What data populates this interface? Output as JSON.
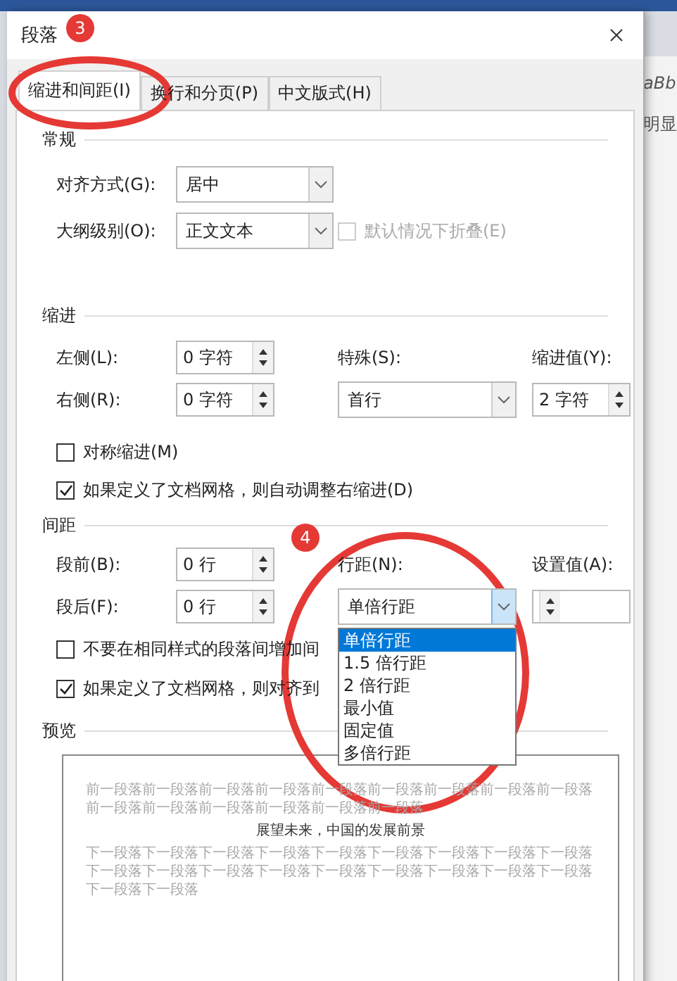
{
  "window": {
    "title": "段落"
  },
  "tabs": [
    {
      "label": "缩进和间距(I)",
      "selected": true
    },
    {
      "label": "换行和分页(P)",
      "selected": false
    },
    {
      "label": "中文版式(H)",
      "selected": false
    }
  ],
  "general": {
    "title": "常规",
    "alignment": {
      "label": "对齐方式(G):",
      "value": "居中"
    },
    "outline_level": {
      "label": "大纲级别(O):",
      "value": "正文文本"
    },
    "collapse": {
      "label": "默认情况下折叠(E)",
      "checked": false,
      "disabled": true
    }
  },
  "indent": {
    "title": "缩进",
    "left": {
      "label": "左侧(L):",
      "value": "0 字符"
    },
    "right": {
      "label": "右侧(R):",
      "value": "0 字符"
    },
    "special": {
      "label": "特殊(S):",
      "value": "首行"
    },
    "by": {
      "label": "缩进值(Y):",
      "value": "2 字符"
    },
    "mirror": {
      "label": "对称缩进(M)",
      "checked": false
    },
    "auto_adjust": {
      "label": "如果定义了文档网格，则自动调整右缩进(D)",
      "checked": true
    }
  },
  "spacing": {
    "title": "间距",
    "before": {
      "label": "段前(B):",
      "value": "0 行"
    },
    "after": {
      "label": "段后(F):",
      "value": "0 行"
    },
    "line_spacing": {
      "label": "行距(N):",
      "value": "单倍行距",
      "expanded": true,
      "options": [
        {
          "label": "单倍行距",
          "selected": true
        },
        {
          "label": "1.5 倍行距",
          "selected": false
        },
        {
          "label": "2 倍行距",
          "selected": false
        },
        {
          "label": "最小值",
          "selected": false
        },
        {
          "label": "固定值",
          "selected": false
        },
        {
          "label": "多倍行距",
          "selected": false
        }
      ]
    },
    "at": {
      "label": "设置值(A):"
    },
    "no_space": {
      "label": "不要在相同样式的段落间增加间",
      "checked": false
    },
    "snap": {
      "label": "如果定义了文档网格，则对齐到",
      "checked": true
    }
  },
  "preview": {
    "title": "预览",
    "previous": "前一段落前一段落前一段落前一段落前一段落前一段落前一段落前一段落前一段落前一段落前一段落前一段落前一段落前一段落前一段落",
    "current": "展望未来，中国的发展前景",
    "next": "下一段落下一段落下一段落下一段落下一段落下一段落下一段落下一段落下一段落下一段落下一段落下一段落下一段落下一段落下一段落下一段落下一段落下一段落下一段落下一段落"
  },
  "annotations": [
    {
      "label": "3"
    },
    {
      "label": "4"
    }
  ],
  "background": {
    "texts": [
      "aBb",
      "明显"
    ]
  }
}
